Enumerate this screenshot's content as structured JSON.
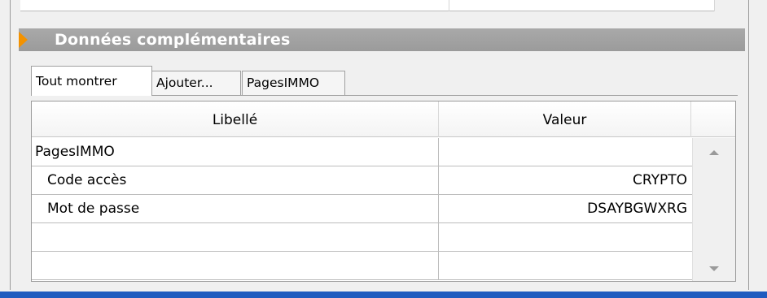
{
  "section": {
    "title": "Données complémentaires",
    "accent_color": "#f39200",
    "header_color": "#a3a3a3"
  },
  "tabs": [
    {
      "label": "Tout montrer",
      "active": true
    },
    {
      "label": "Ajouter...",
      "active": false
    },
    {
      "label": "PagesIMMO",
      "active": false
    }
  ],
  "grid": {
    "columns": [
      "Libellé",
      "Valeur"
    ],
    "rows": [
      {
        "libelle": "PagesIMMO",
        "valeur": ""
      },
      {
        "libelle": "Code accès",
        "valeur": "CRYPTO"
      },
      {
        "libelle": "Mot de passe",
        "valeur": "DSAYBGWXRG"
      },
      {
        "libelle": "",
        "valeur": ""
      },
      {
        "libelle": "",
        "valeur": ""
      }
    ]
  },
  "bottom_bar_color": "#1f5bbf"
}
